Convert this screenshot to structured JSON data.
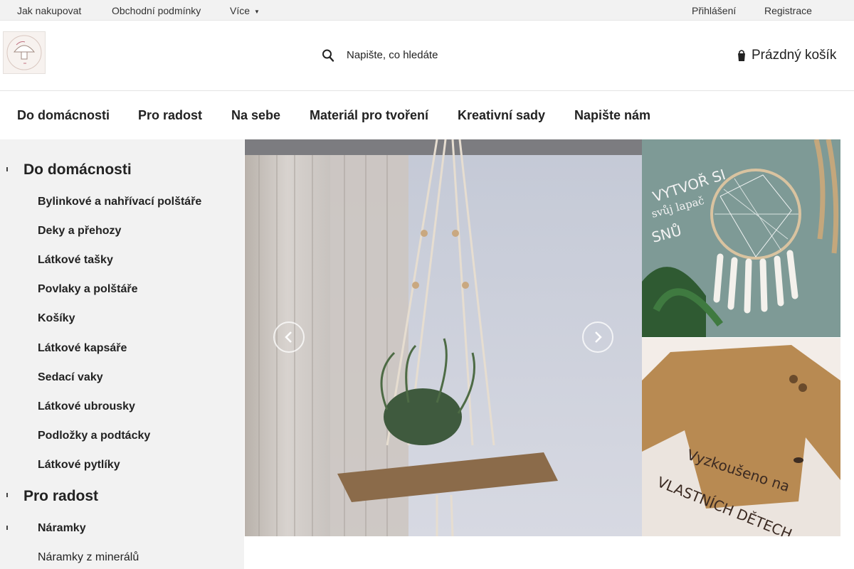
{
  "topbar": {
    "links": [
      "Jak nakupovat",
      "Obchodní podmínky",
      "Více"
    ],
    "more_indicator": "▼",
    "login": "Přihlášení",
    "register": "Registrace"
  },
  "header": {
    "search_placeholder": "Napište, co hledáte",
    "cart_label": "Prázdný košík"
  },
  "main_nav": [
    "Do domácnosti",
    "Pro radost",
    "Na sebe",
    "Materiál pro tvoření",
    "Kreativní sady",
    "Napište nám"
  ],
  "sidebar": {
    "section1": {
      "title": "Do domácnosti",
      "items": [
        "Bylinkové a nahřívací polštáře",
        "Deky a přehozy",
        "Látkové tašky",
        "Povlaky a polštáře",
        "Košíky",
        "Látkové kapsáře",
        "Sedací vaky",
        "Látkové ubrousky",
        "Podložky a podtácky",
        "Látkové pytlíky"
      ]
    },
    "section2": {
      "title": "Pro radost",
      "subsection": "Náramky",
      "leaf": "Náramky z minerálů"
    }
  },
  "banner": {
    "promo1_text": [
      "VYTVOŘ SI",
      "svůj lapač",
      "SNŮ"
    ],
    "promo2_text": [
      "Vyzkoušeno na",
      "VLASTNÍCH DĚTECH"
    ]
  },
  "colors": {
    "topbar_bg": "#f2f2f2",
    "sidebar_bg": "#f2f2f2",
    "text": "#222222",
    "divider": "#e3e3e3"
  },
  "icons": {
    "search": "search-icon",
    "cart": "cart-icon",
    "prev": "chevron-left-icon",
    "next": "chevron-right-icon"
  }
}
